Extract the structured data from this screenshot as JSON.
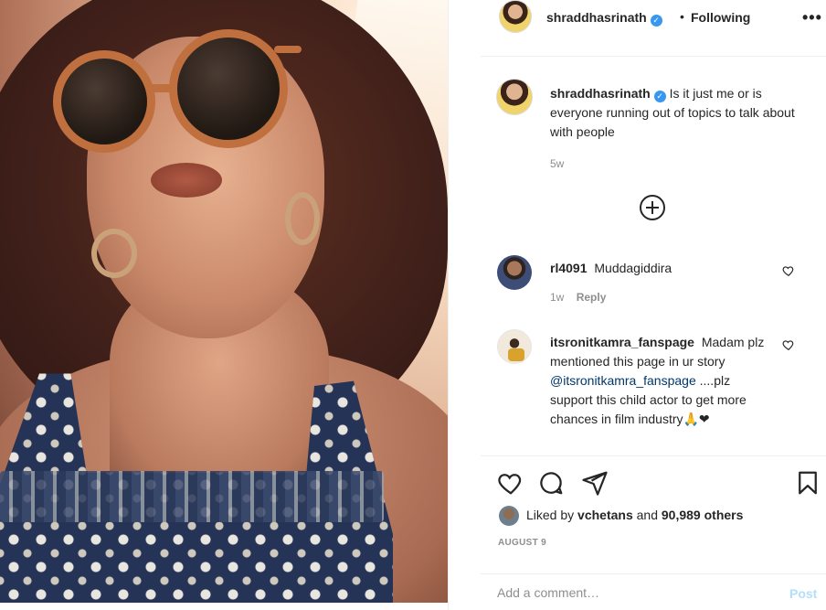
{
  "post": {
    "owner": "shraddhasrinath",
    "follow_separator": "•",
    "follow_state": "Following",
    "more_label": "•••",
    "caption": "Is it just me or is everyone running out of topics to talk about with people",
    "caption_time": "5w"
  },
  "comments": [
    {
      "username": "rl4091",
      "text": "Muddagiddira",
      "time": "1w",
      "reply_label": "Reply"
    },
    {
      "username": "itsronitkamra_fanspage",
      "text_before": "Madam plz mentioned this page in ur story",
      "mention": "@itsronitkamra_fanspage",
      "text_after": "....plz support this child actor to get more chances in film industry🙏❤"
    }
  ],
  "likes": {
    "prefix": "Liked by",
    "user": "vchetans",
    "middle": "and",
    "others": "90,989 others"
  },
  "date": "AUGUST 9",
  "add_comment": {
    "placeholder": "Add a comment…",
    "post_label": "Post"
  },
  "icons": {
    "verified": "verified-badge-icon",
    "load_more": "plus-circle-icon",
    "like": "heart-icon",
    "comment": "comment-bubble-icon",
    "share": "paper-plane-icon",
    "save": "bookmark-icon"
  },
  "colors": {
    "text": "#262626",
    "muted": "#8e8e8e",
    "verified": "#3897f0",
    "mention": "#00376b",
    "post_disabled": "#b2dffc",
    "border": "#efefef"
  }
}
